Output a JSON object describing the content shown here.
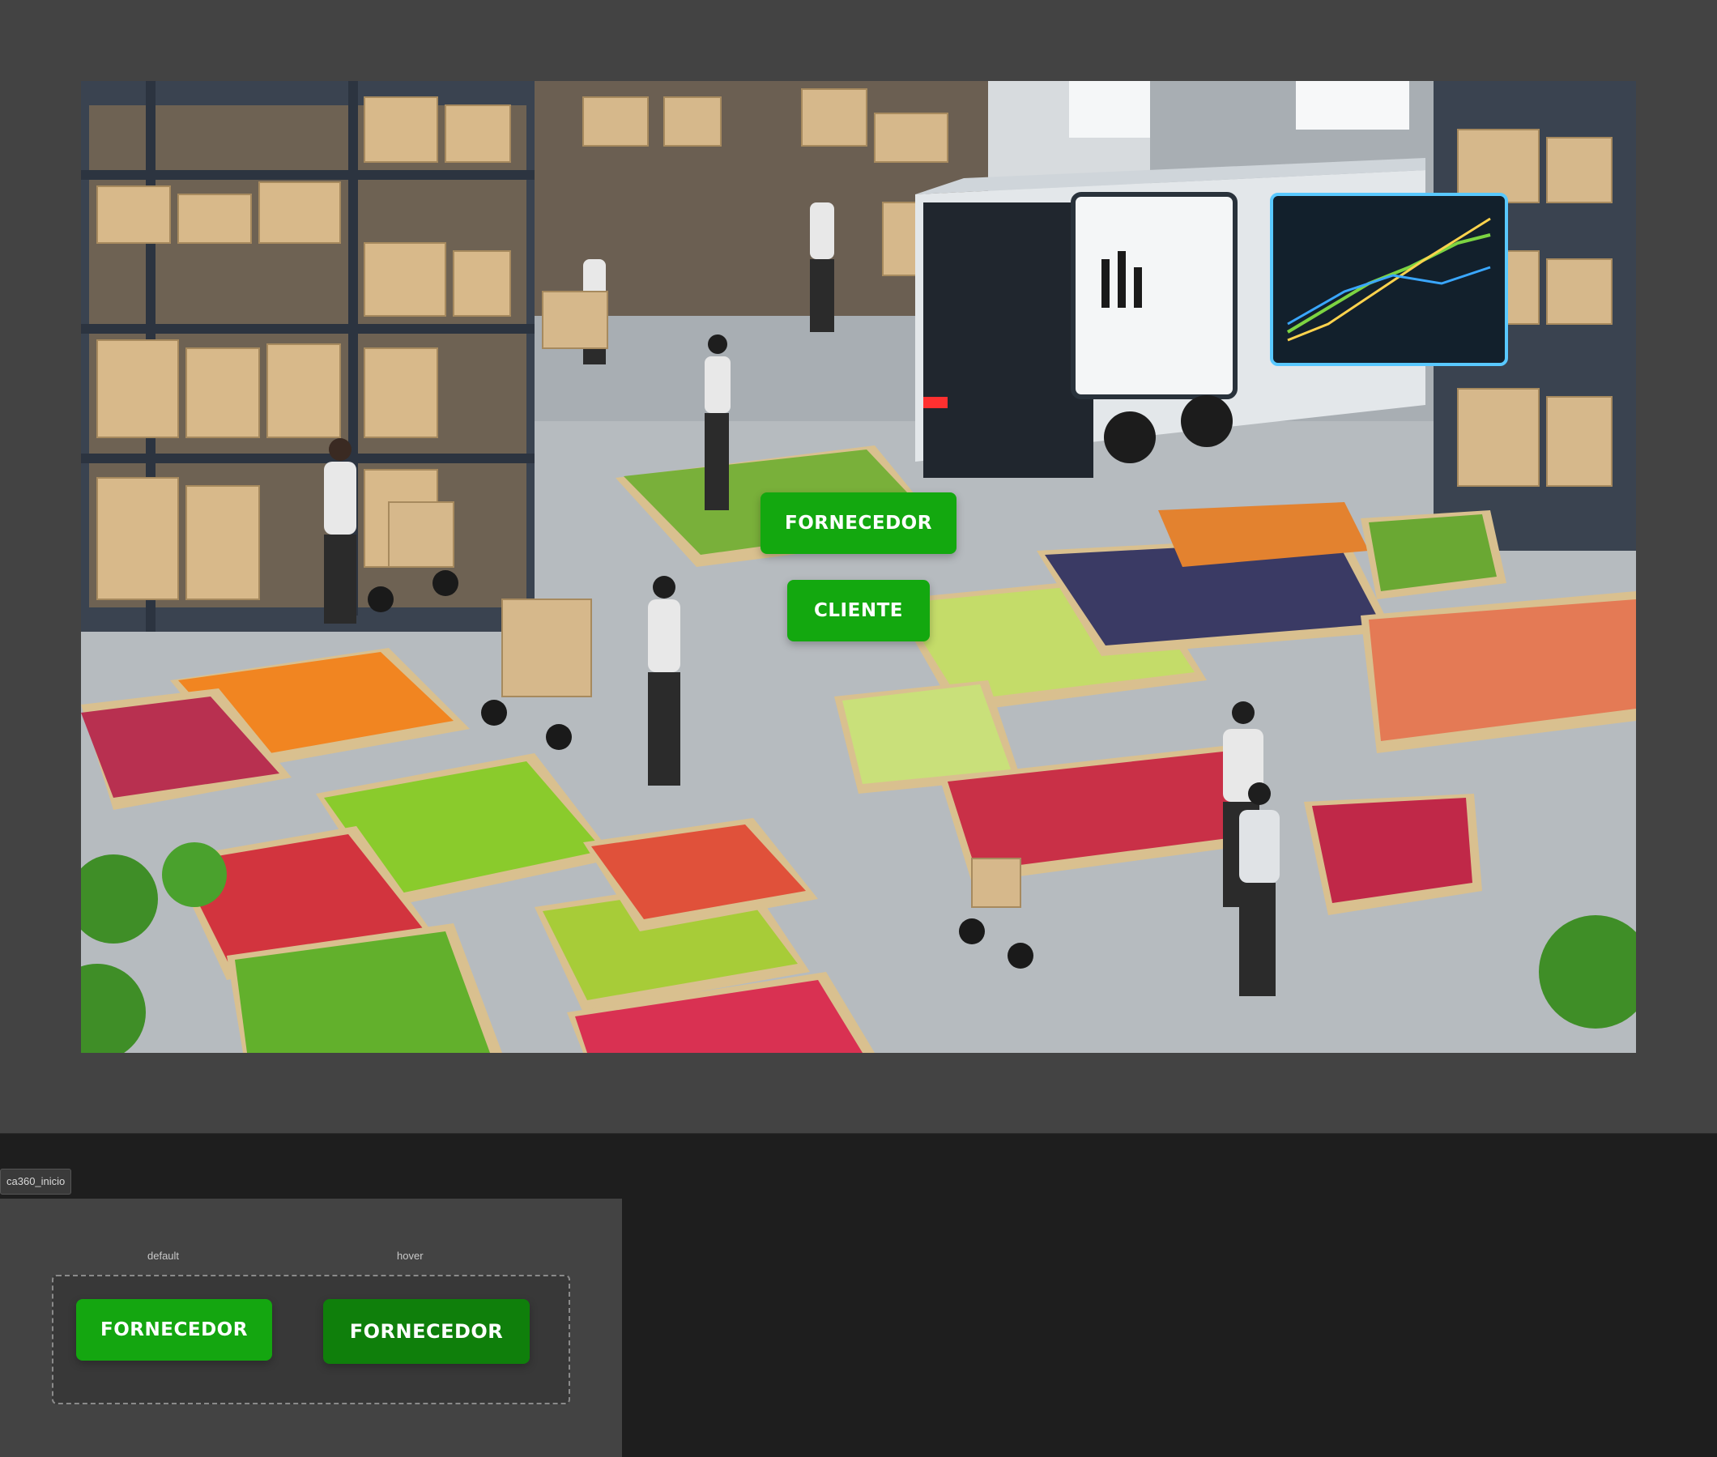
{
  "canvas": {
    "background_color": "#434343",
    "scene_image": "warehouse-illustration"
  },
  "scene_buttons": {
    "fornecedor_label": "FORNECEDOR",
    "cliente_label": "CLIENTE",
    "button_color": "#13a80f"
  },
  "component": {
    "name": "ca360_inicio",
    "variants": [
      {
        "state": "default",
        "label": "FORNECEDOR",
        "color": "#14a610"
      },
      {
        "state": "hover",
        "label": "FORNECEDOR",
        "color": "#0f7f0b"
      }
    ]
  }
}
